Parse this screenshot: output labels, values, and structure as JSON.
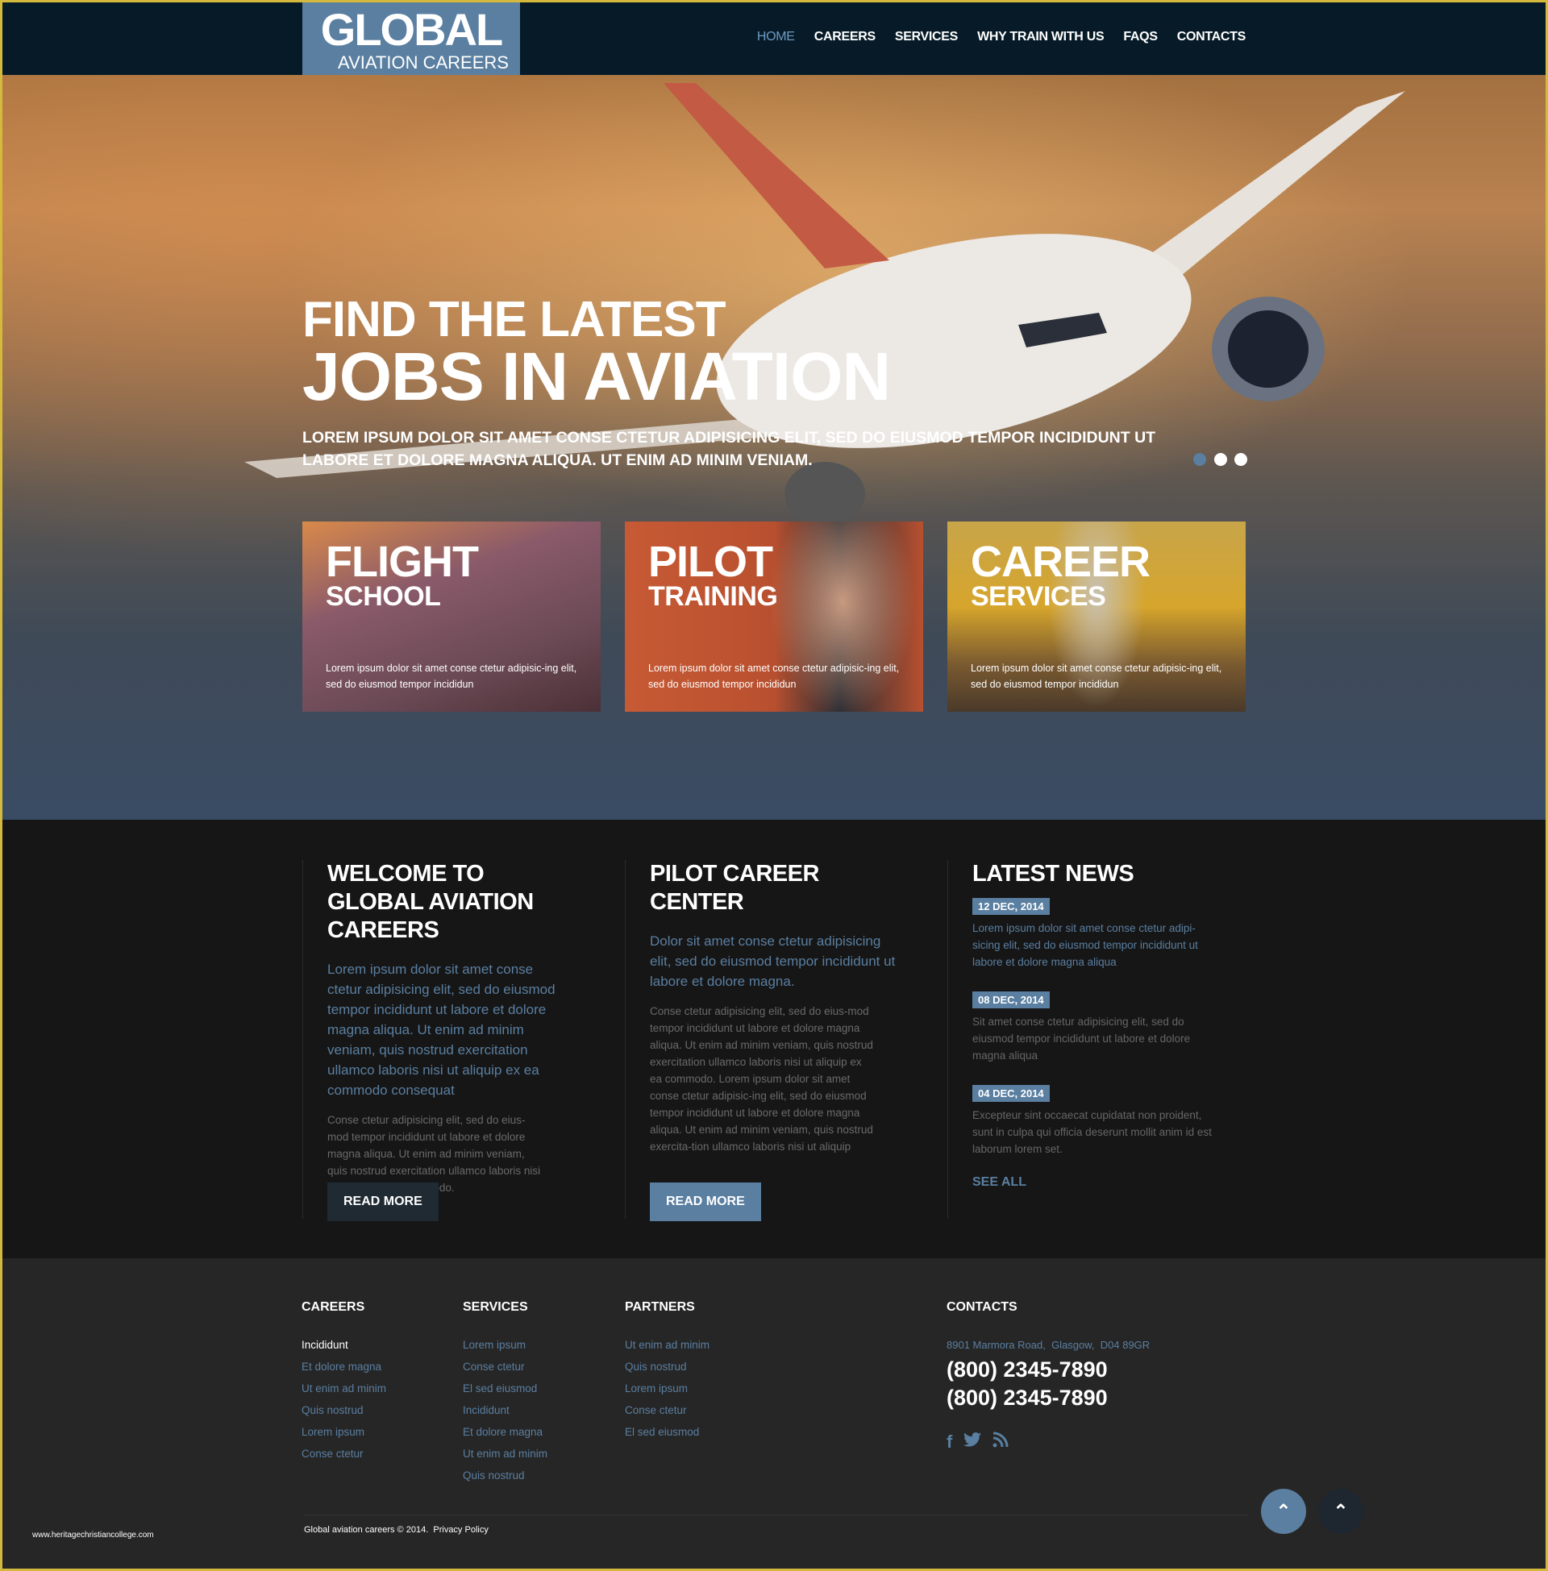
{
  "header": {
    "logo_line1": "GLOBAL",
    "logo_line2": "AVIATION CAREERS",
    "nav": [
      {
        "label": "HOME",
        "active": true
      },
      {
        "label": "CAREERS"
      },
      {
        "label": "SERVICES"
      },
      {
        "label": "WHY TRAIN WITH US"
      },
      {
        "label": "FAQS"
      },
      {
        "label": "CONTACTS"
      }
    ]
  },
  "hero": {
    "title_line1": "FIND THE LATEST",
    "title_line2": "JOBS IN AVIATION",
    "subtitle": "LOREM IPSUM DOLOR SIT AMET CONSE CTETUR ADIPISICING ELIT, SED DO EIUSMOD TEMPOR INCIDIDUNT UT LABORE ET DOLORE MAGNA ALIQUA. UT ENIM AD MINIM VENIAM.",
    "slider": {
      "count": 3,
      "active_index": 0
    },
    "cards": [
      {
        "title1": "FLIGHT",
        "title2": "SCHOOL",
        "text": "Lorem ipsum dolor sit amet conse ctetur adipisic-ing elit, sed do eiusmod tempor incididun"
      },
      {
        "title1": "PILOT",
        "title2": "TRAINING",
        "text": "Lorem ipsum dolor sit amet conse ctetur adipisic-ing elit, sed do eiusmod tempor incididun"
      },
      {
        "title1": "CAREER",
        "title2": "SERVICES",
        "text": "Lorem ipsum dolor sit amet conse ctetur adipisic-ing elit, sed do eiusmod tempor incididun"
      }
    ]
  },
  "main": {
    "welcome": {
      "title": "WELCOME TO GLOBAL AVIATION CAREERS",
      "lead": "Lorem ipsum dolor sit amet conse ctetur adipisicing elit, sed do eiusmod tempor incididunt ut labore et dolore magna aliqua. Ut enim ad minim veniam, quis nostrud exercitation ullamco laboris nisi ut aliquip ex ea commodo consequat",
      "text": "Conse ctetur adipisicing elit, sed do eius-mod tempor incididunt ut labore et dolore magna aliqua. Ut enim ad minim veniam, quis nostrud exercitation ullamco laboris nisi ut aliquip ex ea commodo.",
      "button": "READ MORE"
    },
    "pilot": {
      "title": "PILOT CAREER CENTER",
      "lead": "Dolor sit amet conse ctetur adipisicing elit, sed do eiusmod tempor incididunt ut labore et dolore magna.",
      "text": "Conse ctetur adipisicing elit, sed do eius-mod tempor incididunt ut labore et dolore magna aliqua. Ut enim ad minim veniam, quis nostrud exercitation ullamco laboris nisi ut aliquip ex ea commodo. Lorem ipsum dolor sit amet conse ctetur adipisic-ing elit, sed do eiusmod tempor incididunt ut labore et dolore magna aliqua. Ut enim ad minim veniam, quis nostrud exercita-tion ullamco laboris nisi ut aliquip",
      "button": "READ MORE"
    },
    "news": {
      "title": "LATEST NEWS",
      "items": [
        {
          "date": "12 DEC, 2014",
          "text": "Lorem ipsum dolor sit amet conse ctetur adipi-sicing elit, sed do eiusmod tempor incididunt ut labore et dolore magna aliqua"
        },
        {
          "date": "08 DEC, 2014",
          "text": "Sit amet conse ctetur adipisicing elit, sed do eiusmod tempor incididunt ut labore et dolore magna aliqua"
        },
        {
          "date": "04 DEC, 2014",
          "text": "Excepteur sint occaecat cupidatat non proident, sunt in culpa qui officia deserunt mollit anim id est laborum lorem set."
        }
      ],
      "see_all": "SEE ALL"
    }
  },
  "footer": {
    "careers": {
      "title": "CAREERS",
      "links": [
        "Incididunt",
        "Et dolore magna",
        "Ut enim ad minim",
        "Quis nostrud",
        "Lorem ipsum",
        "Conse ctetur"
      ]
    },
    "services": {
      "title": "SERVICES",
      "links": [
        "Lorem ipsum",
        "Conse ctetur",
        "El sed eiusmod",
        "Incididunt",
        "Et dolore magna",
        "Ut enim ad minim",
        "Quis nostrud"
      ]
    },
    "partners": {
      "title": "PARTNERS",
      "links": [
        "Ut enim ad minim",
        "Quis nostrud",
        "Lorem ipsum",
        "Conse ctetur",
        "El sed eiusmod"
      ]
    },
    "contacts": {
      "title": "CONTACTS",
      "address": "8901 Marmora Road,  Glasgow,  D04 89GR",
      "phone1": "(800) 2345-7890",
      "phone2": "(800) 2345-7890",
      "social": [
        "facebook-icon",
        "twitter-icon",
        "rss-icon"
      ]
    },
    "copyright": "Global aviation careers © 2014.",
    "privacy": "Privacy Policy",
    "watermark": "www.heritagechristiancollege.com"
  },
  "colors": {
    "accent": "#5a7fa1",
    "header_bg": "#061b27",
    "dark_bg": "#161616",
    "footer_bg": "#262626",
    "border": "#d4b93c"
  }
}
